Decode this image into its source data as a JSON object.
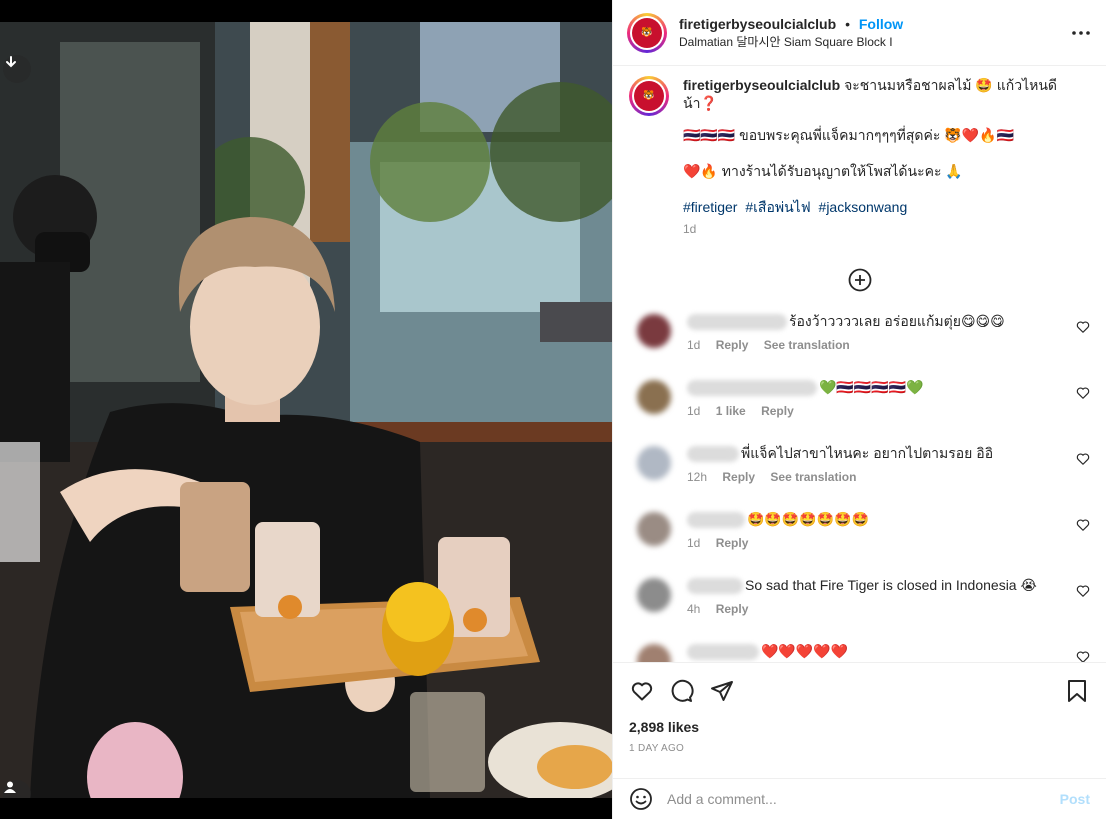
{
  "post": {
    "username": "firetigerbyseoulcialclub",
    "follow_label": "Follow",
    "separator": "•",
    "location": "Dalmatian 달마시안 Siam Square Block I",
    "avatar_text": "FIRE TIGER"
  },
  "caption": {
    "username": "firetigerbyseoulcialclub",
    "line1": "จะชานมหรือชาผลไม้ 🤩 แก้วไหนดีน้า❓",
    "line2": "🇹🇭🇹🇭🇹🇭 ขอบพระคุณพี่แจ็คมากๆๆๆที่สุดค่ะ 🐯❤️🔥🇹🇭",
    "line3": "❤️🔥 ทางร้านได้รับอนุญาตให้โพสได้นะคะ 🙏",
    "hashtags": [
      "#firetiger",
      "#เสือพ่นไฟ",
      "#jacksonwang"
    ],
    "time": "1d"
  },
  "comments": [
    {
      "text": "ร้องว้าววววเลย อร่อยแก้มตุ่ย😋😋😋",
      "time": "1d",
      "likes": "",
      "reply": "Reply",
      "translate": "See translation",
      "avatar_color": "#7a3a3f"
    },
    {
      "text": "💚🇹🇭🇹🇭🇹🇭🇹🇭💚",
      "time": "1d",
      "likes": "1 like",
      "reply": "Reply",
      "translate": "",
      "avatar_color": "#8a7050"
    },
    {
      "text": "พี่แจ็คไปสาขาไหนคะ อยากไปตามรอย อิอิ",
      "time": "12h",
      "likes": "",
      "reply": "Reply",
      "translate": "See translation",
      "avatar_color": "#b0b8c4"
    },
    {
      "text": "🤩🤩🤩🤩🤩🤩🤩",
      "time": "1d",
      "likes": "",
      "reply": "Reply",
      "translate": "",
      "avatar_color": "#9a8c84"
    },
    {
      "text": "So sad that Fire Tiger is closed in Indonesia 😭",
      "time": "4h",
      "likes": "",
      "reply": "Reply",
      "translate": "",
      "avatar_color": "#8c8c8c"
    },
    {
      "text": "❤️❤️❤️❤️❤️",
      "time": "",
      "likes": "",
      "reply": "",
      "translate": "",
      "avatar_color": "#a08070"
    }
  ],
  "actions": {
    "likes": "2,898 likes",
    "date": "1 DAY AGO"
  },
  "comment_box": {
    "placeholder": "Add a comment...",
    "post_label": "Post"
  },
  "icons": {
    "download": "download-icon",
    "tag": "user-tag-icon",
    "more": "more-options-icon",
    "load_more": "plus-circle-icon",
    "like": "heart-icon",
    "comment": "comment-icon",
    "share": "share-icon",
    "save": "bookmark-icon",
    "emoji": "emoji-icon"
  }
}
